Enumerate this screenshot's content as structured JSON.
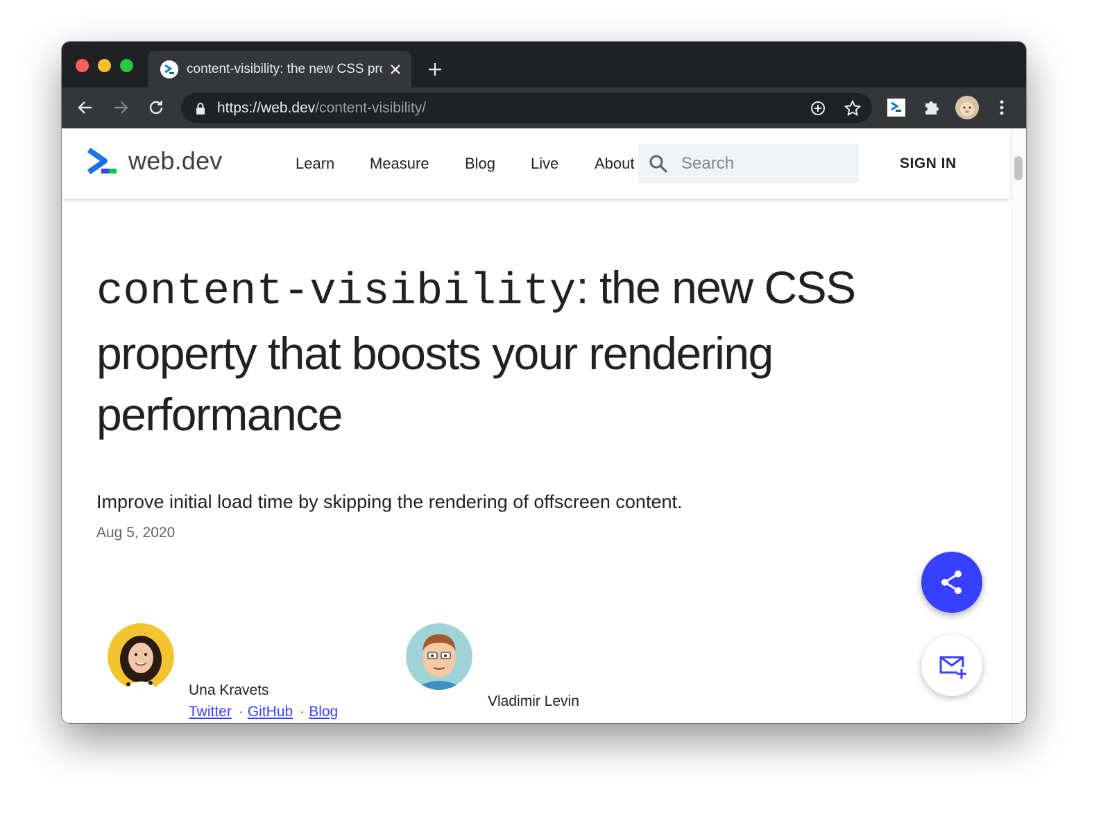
{
  "browser": {
    "tab_title": "content-visibility: the new CSS property that boosts your rendering performance",
    "url_scheme": "https://",
    "url_host": "web.dev",
    "url_path": "/content-visibility/"
  },
  "site": {
    "logo_text": "web.dev",
    "nav": [
      "Learn",
      "Measure",
      "Blog",
      "Live",
      "About"
    ],
    "search_placeholder": "Search",
    "sign_in": "SIGN IN"
  },
  "article": {
    "headline_code": "content-visibility",
    "headline_rest": ": the new CSS property that boosts your rendering performance",
    "subtitle": "Improve initial load time by skipping the rendering of offscreen content.",
    "date": "Aug 5, 2020",
    "authors": [
      {
        "name": "Una Kravets",
        "links": [
          "Twitter",
          "GitHub",
          "Blog"
        ]
      },
      {
        "name": "Vladimir Levin"
      }
    ]
  },
  "colors": {
    "accent": "#3740ff",
    "browser_frame": "#202124",
    "toolbar": "#35363a"
  }
}
